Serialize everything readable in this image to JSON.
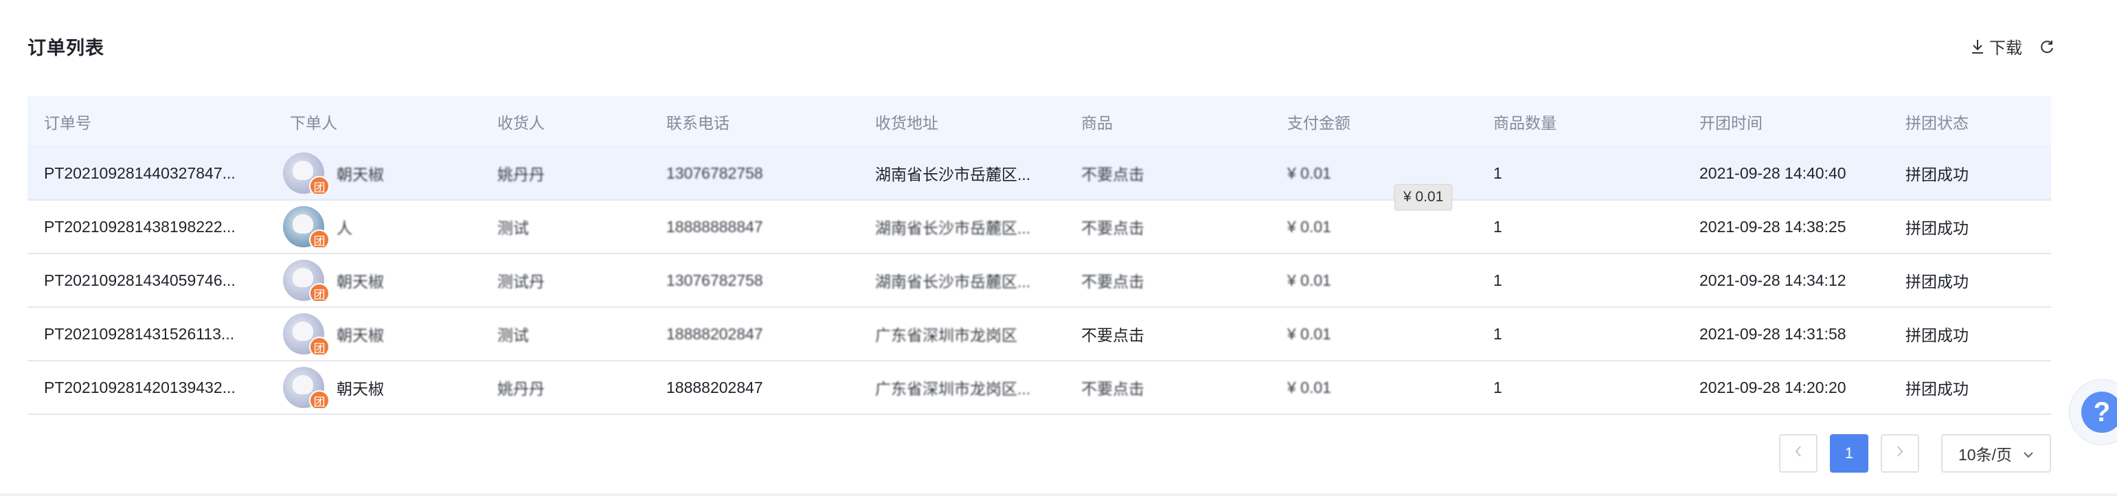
{
  "header": {
    "title": "订单列表",
    "download_label": "下载",
    "download_icon": "download-icon",
    "refresh_icon": "refresh-icon"
  },
  "table": {
    "columns": [
      "订单号",
      "下单人",
      "收货人",
      "联系电话",
      "收货地址",
      "商品",
      "支付金额",
      "商品数量",
      "开团时间",
      "拼团状态"
    ],
    "rows": [
      {
        "order_no": "PT202109281440327847...",
        "buyer": "朝天椒",
        "receiver": "姚丹丹",
        "phone": "13076782758",
        "address": "湖南省长沙市岳麓区...",
        "product": "不要点击",
        "amount": "¥ 0.01",
        "quantity": "1",
        "time": "2021-09-28 14:40:40",
        "status": "拼团成功",
        "badge": "团"
      },
      {
        "order_no": "PT202109281438198222...",
        "buyer": "人",
        "receiver": "测试",
        "phone": "18888888847",
        "address": "湖南省长沙市岳麓区...",
        "product": "不要点击",
        "amount": "¥ 0.01",
        "quantity": "1",
        "time": "2021-09-28 14:38:25",
        "status": "拼团成功",
        "badge": "团"
      },
      {
        "order_no": "PT202109281434059746...",
        "buyer": "朝天椒",
        "receiver": "测试丹",
        "phone": "13076782758",
        "address": "湖南省长沙市岳麓区...",
        "product": "不要点击",
        "amount": "¥ 0.01",
        "quantity": "1",
        "time": "2021-09-28 14:34:12",
        "status": "拼团成功",
        "badge": "团"
      },
      {
        "order_no": "PT202109281431526113...",
        "buyer": "朝天椒",
        "receiver": "测试",
        "phone": "18888202847",
        "address": "广东省深圳市龙岗区",
        "product": "不要点击",
        "amount": "¥ 0.01",
        "quantity": "1",
        "time": "2021-09-28 14:31:58",
        "status": "拼团成功",
        "badge": "团"
      },
      {
        "order_no": "PT202109281420139432...",
        "buyer": "朝天椒",
        "receiver": "姚丹丹",
        "phone": "18888202847",
        "address": "广东省深圳市龙岗区...",
        "product": "不要点击",
        "amount": "¥ 0.01",
        "quantity": "1",
        "time": "2021-09-28 14:20:20",
        "status": "拼团成功",
        "badge": "团"
      }
    ]
  },
  "tooltip": {
    "text": "¥ 0.01"
  },
  "pagination": {
    "prev_icon": "chevron-left-icon",
    "current_page": "1",
    "next_icon": "chevron-right-icon",
    "page_size_label": "10条/页"
  },
  "help": {
    "icon": "help-icon",
    "symbol": "?"
  },
  "colors": {
    "accent": "#4f84f0",
    "header_bg": "#f1f6ff",
    "badge": "#f07a3a"
  }
}
